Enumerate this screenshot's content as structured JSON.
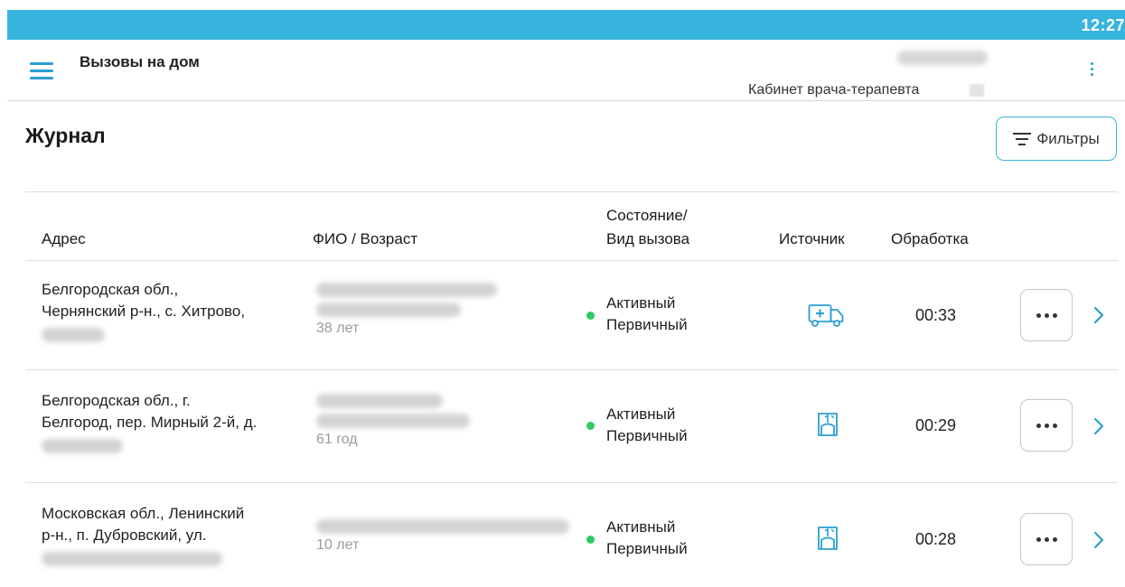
{
  "status_bar": {
    "time": "12:27"
  },
  "app_bar": {
    "title": "Вызовы на дом",
    "cabinet": "Кабинет врача-терапевта"
  },
  "page": {
    "title": "Журнал",
    "filters_label": "Фильтры"
  },
  "table": {
    "headers": {
      "address": "Адрес",
      "fio": "ФИО / Возраст",
      "state_line1": "Состояние/",
      "state_line2": "Вид вызова",
      "source": "Источник",
      "processing": "Обработка"
    },
    "rows": [
      {
        "address_line1": "Белгородская обл.,",
        "address_line2": "Чернянский р-н., с. Хитрово,",
        "age": "38 лет",
        "state": "Активный",
        "type": "Первичный",
        "source_icon": "ambulance-icon",
        "processing": "00:33"
      },
      {
        "address_line1": "Белгородская обл., г.",
        "address_line2": "Белгород, пер. Мирный 2-й, д.",
        "age": "61 год",
        "state": "Активный",
        "type": "Первичный",
        "source_icon": "portal-icon",
        "processing": "00:29"
      },
      {
        "address_line1": "Московская обл., Ленинский",
        "address_line2": "р-н., п. Дубровский, ул.",
        "age": "10 лет",
        "state": "Активный",
        "type": "Первичный",
        "source_icon": "portal-icon",
        "processing": "00:28"
      }
    ]
  },
  "colors": {
    "accent": "#37b4dd",
    "status_active": "#2ecb63",
    "icon_blue": "#2a9fd2"
  }
}
